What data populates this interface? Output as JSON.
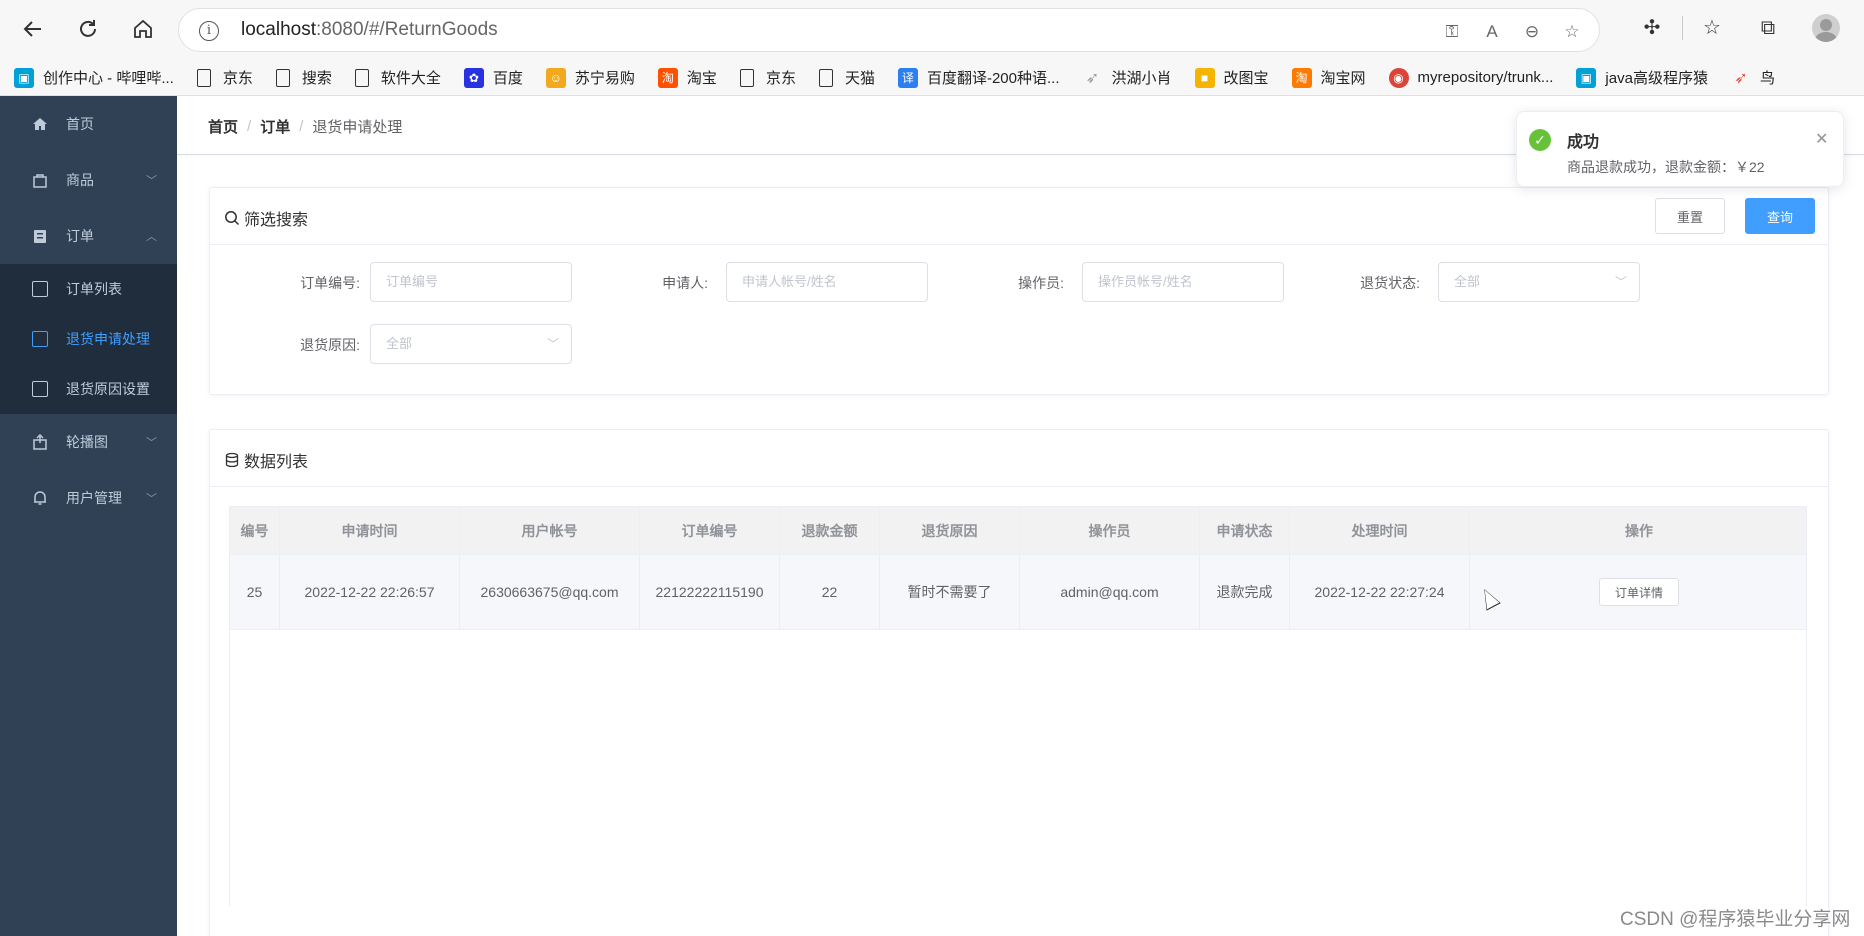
{
  "browser": {
    "url_host": "localhost",
    "url_rest": ":8080/#/ReturnGoods",
    "bookmarks": [
      {
        "label": "创作中心 - 哔哩哔...",
        "icon": "bilibili-icon",
        "color": "#00a1d6"
      },
      {
        "label": "京东",
        "icon": "document-icon",
        "color": ""
      },
      {
        "label": "搜索",
        "icon": "document-icon",
        "color": ""
      },
      {
        "label": "软件大全",
        "icon": "document-icon",
        "color": ""
      },
      {
        "label": "百度",
        "icon": "baidu-paw-icon",
        "color": "#2932e1"
      },
      {
        "label": "苏宁易购",
        "icon": "suning-icon",
        "color": "#f2a91d"
      },
      {
        "label": "淘宝",
        "icon": "taobao-icon",
        "color": "#ff5000"
      },
      {
        "label": "京东",
        "icon": "document-icon",
        "color": ""
      },
      {
        "label": "天猫",
        "icon": "document-icon",
        "color": ""
      },
      {
        "label": "百度翻译-200种语...",
        "icon": "translate-icon",
        "color": "#2b7ff0"
      },
      {
        "label": "洪湖小肖",
        "icon": "bird-icon",
        "color": "#999999"
      },
      {
        "label": "改图宝",
        "icon": "gaitubao-icon",
        "color": "#f5b400"
      },
      {
        "label": "淘宝网",
        "icon": "taobao-icon",
        "color": "#ff7a00"
      },
      {
        "label": "myrepository/trunk...",
        "icon": "chrome-icon",
        "color": "#db4437"
      },
      {
        "label": "java高级程序猿",
        "icon": "bilibili-icon",
        "color": "#00a1d6"
      },
      {
        "label": "鸟",
        "icon": "bird-icon",
        "color": "#e74c3c"
      }
    ]
  },
  "sidebar": {
    "items": [
      {
        "label": "首页",
        "icon": "home-icon",
        "arrow": ""
      },
      {
        "label": "商品",
        "icon": "shopping-bag-icon",
        "arrow": "﹀"
      },
      {
        "label": "订单",
        "icon": "clipboard-icon",
        "arrow": "︿"
      },
      {
        "label": "轮播图",
        "icon": "upload-icon",
        "arrow": "﹀"
      },
      {
        "label": "用户管理",
        "icon": "bell-icon",
        "arrow": "﹀"
      }
    ],
    "subitems": [
      {
        "label": "订单列表",
        "icon": "list-icon"
      },
      {
        "label": "退货申请处理",
        "icon": "return-bag-icon"
      },
      {
        "label": "退货原因设置",
        "icon": "edit-icon"
      }
    ]
  },
  "breadcrumb": {
    "home": "首页",
    "order": "订单",
    "current": "退货申请处理",
    "sep": "/"
  },
  "filter": {
    "title": "筛选搜索",
    "reset": "重置",
    "query": "查询",
    "fields": {
      "order_no": {
        "label": "订单编号:",
        "placeholder": "订单编号"
      },
      "applicant": {
        "label": "申请人:",
        "placeholder": "申请人帐号/姓名"
      },
      "operator": {
        "label": "操作员:",
        "placeholder": "操作员帐号/姓名"
      },
      "status": {
        "label": "退货状态:",
        "value": "全部"
      },
      "reason": {
        "label": "退货原因:",
        "value": "全部"
      }
    }
  },
  "list": {
    "title": "数据列表",
    "columns": [
      "编号",
      "申请时间",
      "用户帐号",
      "订单编号",
      "退款金额",
      "退货原因",
      "操作员",
      "申请状态",
      "处理时间",
      "操作"
    ],
    "rows": [
      [
        "25",
        "2022-12-22 22:26:57",
        "2630663675@qq.com",
        "22122222115190",
        "22",
        "暂时不需要了",
        "admin@qq.com",
        "退款完成",
        "2022-12-22 22:27:24",
        "订单详情"
      ]
    ]
  },
  "notification": {
    "title": "成功",
    "message": "商品退款成功，退款金额：￥22",
    "color": "#67c23a"
  },
  "watermark": "CSDN @程序猿毕业分享网"
}
